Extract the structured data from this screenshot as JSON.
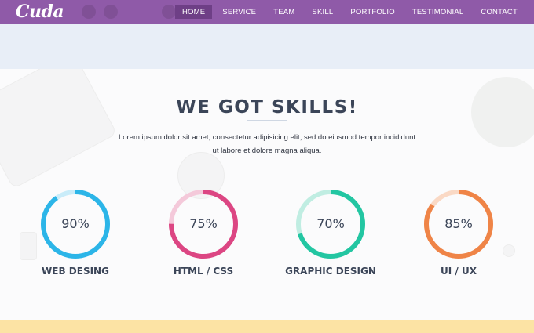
{
  "brand": {
    "logo_text": "Cuda"
  },
  "nav": {
    "items": [
      {
        "label": "HOME",
        "active": true
      },
      {
        "label": "SERVICE",
        "active": false
      },
      {
        "label": "TEAM",
        "active": false
      },
      {
        "label": "SKILL",
        "active": false
      },
      {
        "label": "PORTFOLIO",
        "active": false
      },
      {
        "label": "TESTIMONIAL",
        "active": false
      },
      {
        "label": "CONTACT",
        "active": false
      }
    ]
  },
  "skills_section": {
    "title": "WE GOT SKILLS!",
    "intro_line1": "Lorem ipsum dolor sit amet, consectetur adipisicing elit, sed do eiusmod tempor incididunt",
    "intro_line2": "ut labore et dolore magna aliqua.",
    "skills": [
      {
        "label": "WEB DESING",
        "percent": 90,
        "percent_text": "90%",
        "color": "#2cb5e8",
        "track_color": "#c9ecf9"
      },
      {
        "label": "HTML / CSS",
        "percent": 75,
        "percent_text": "75%",
        "color": "#dc4683",
        "track_color": "#f4c9da"
      },
      {
        "label": "GRAPHIC DESIGN",
        "percent": 70,
        "percent_text": "70%",
        "color": "#23c6a2",
        "track_color": "#c0ede2"
      },
      {
        "label": "UI / UX",
        "percent": 85,
        "percent_text": "85%",
        "color": "#ef8447",
        "track_color": "#fad9c5"
      }
    ]
  },
  "colors": {
    "nav_bg": "#8f5aa8",
    "nav_active": "#6e3f86",
    "band_bg": "#e8eef7",
    "heading": "#3b4558",
    "bottom_strip": "#fce3a4"
  }
}
